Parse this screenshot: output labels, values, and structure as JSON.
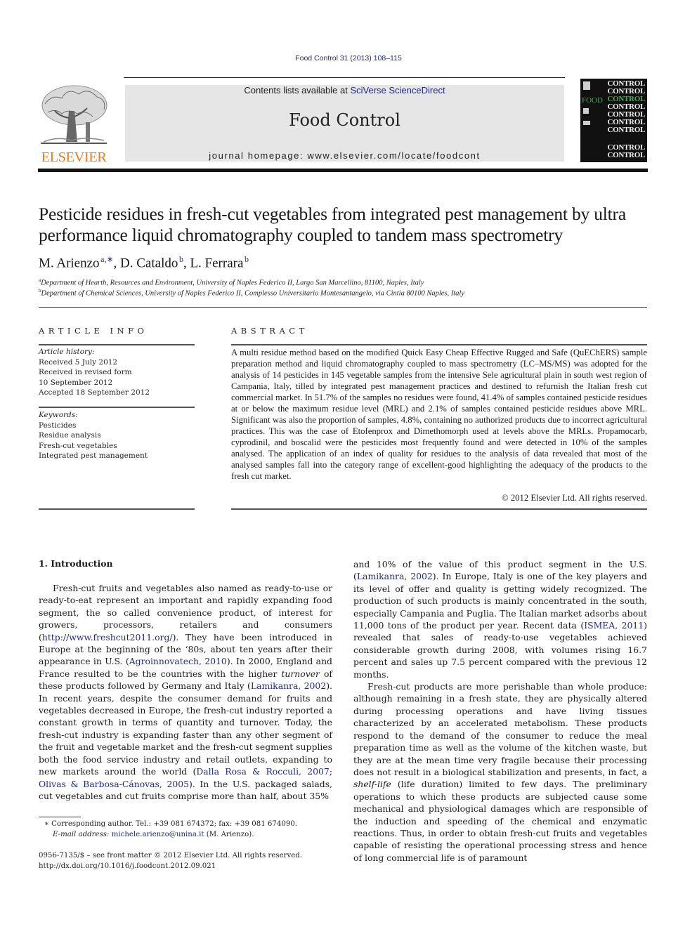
{
  "header": {
    "journal_ref": "Food Control 31 (2013) 108–115",
    "contents_prefix": "Contents lists available at ",
    "contents_link": "SciVerse ScienceDirect",
    "journal_title": "Food Control",
    "homepage": "journal homepage: www.elsevier.com/locate/foodcont",
    "publisher_logo": "ELSEVIER",
    "cover": {
      "word": "CONTROL",
      "food": "FOOD"
    }
  },
  "article": {
    "title": "Pesticide residues in fresh-cut vegetables from integrated pest management by ultra performance liquid chromatography coupled to tandem mass spectrometry",
    "authors": [
      {
        "name": "M. Arienzo",
        "sup": "a,∗",
        "sep": ", "
      },
      {
        "name": "D. Cataldo",
        "sup": "b",
        "sep": ", "
      },
      {
        "name": "L. Ferrara",
        "sup": "b",
        "sep": ""
      }
    ],
    "affiliations": [
      {
        "mark": "a",
        "text": "Department of Hearth, Resources and Environment, University of Naples Federico II, Largo San Marcellino, 81100, Naples, Italy"
      },
      {
        "mark": "b",
        "text": "Department of Chemical Sciences, University of Naples Federico II, Complesso Universitario Montesantangelo, via Cintia 80100 Naples, Italy"
      }
    ]
  },
  "article_info": {
    "heading": "ARTICLE INFO",
    "history_label": "Article history:",
    "history": [
      "Received 5 July 2012",
      "Received in revised form",
      "10 September 2012",
      "Accepted 18 September 2012"
    ],
    "keywords_label": "Keywords:",
    "keywords": [
      "Pesticides",
      "Residue analysis",
      "Fresh-cut vegetables",
      "Integrated pest management"
    ]
  },
  "abstract": {
    "heading": "ABSTRACT",
    "text": "A multi residue method based on the modified Quick Easy Cheap Effective Rugged and Safe (QuEChERS) sample preparation method and liquid chromatography coupled to mass spectrometry (LC–MS/MS) was adopted for the analysis of 14 pesticides in 145 vegetable samples from the intensive Sele agricultural plain in south west region of Campania, Italy, tilled by integrated pest management practices and destined to refurnish the Italian fresh cut commercial market. In 51.7% of the samples no residues were found, 41.4% of samples contained pesticide residues at or below the maximum residue level (MRL) and 2.1% of samples contained pesticide residues above MRL. Significant was also the proportion of samples, 4.8%, containing no authorized products due to incorrect agricultural practices. This was the case of Etofenprox and Dimethomorph used at levels above the MRLs. Propamocarb, cyprodinil, and boscalid were the pesticides most frequently found and were detected in 10% of the samples analysed. The application of an index of quality for residues to the analysis of data revealed that most of the analysed samples fall into the category range of excellent-good highlighting the adequacy of the products to the fresh cut market.",
    "copyright": "© 2012 Elsevier Ltd. All rights reserved."
  },
  "intro": {
    "heading": "1.  Introduction",
    "left": {
      "p1_a": "Fresh-cut fruits and vegetables also named as ready-to-use or ready-to-eat represent an important and rapidly expanding food segment, the so called convenience product, of interest for growers, processors, retailers and consumers (",
      "p1_link1": "http://www.freshcut2011.org/",
      "p1_b": "). They have been introduced in Europe at the beginning of the ‘80s, about ten years after their appearance in U.S. (",
      "p1_link2": "Agroinnovatech, 2010",
      "p1_c": "). In 2000, England and France resulted to be the countries with the higher ",
      "p1_em": "turnover",
      "p1_d": " of these products followed by Germany and Italy (",
      "p1_link3": "Lamikanra, 2002",
      "p1_e": "). In recent years, despite the consumer demand for fruits and vegetables decreased in Europe, the fresh-cut industry reported a constant growth in terms of quantity and turnover. Today, the fresh-cut industry is expanding faster than any other segment of the fruit and vegetable market and the fresh-cut segment supplies both the food service industry and retail outlets, expanding to new markets around the world (",
      "p1_link4": "Dalla Rosa & Rocculi, 2007",
      "p1_f": "; ",
      "p1_link5": "Olivas & Barbosa-Cánovas, 2005",
      "p1_g": "). In the U.S. packaged salads, cut vegetables and cut fruits comprise more than half, about 35%"
    },
    "right": {
      "p1_a": "and 10% of the value of this product segment in the U.S. (",
      "p1_link1": "Lamikanra, 2002",
      "p1_b": "). In Europe, Italy is one of the key players and its level of offer and quality is getting widely recognized. The production of such products is mainly concentrated in the south, especially Campania and Puglia. The Italian market adsorbs about 11,000 tons of the product per year. Recent data (",
      "p1_link2": "ISMEA, 2011",
      "p1_c": ") revealed that sales of ready-to-use vegetables achieved considerable growth during 2008, with volumes rising 16.7 percent and sales up 7.5 percent compared with the previous 12 months.",
      "p2_a": "Fresh-cut products are more perishable than whole produce: although remaining in a fresh state, they are physically altered during processing operations and have living tissues characterized by an accelerated metabolism. These products respond to the demand of the consumer to reduce the meal preparation time as well as the volume of the kitchen waste, but they are at the mean time very fragile because their processing does not result in a biological stabilization and presents, in fact, a ",
      "p2_em": "shelf-life",
      "p2_b": " (life duration) limited to few days. The preliminary operations to which these products are subjected cause some mechanical and physiological damages which are responsible of the induction and speeding of the chemical and enzymatic reactions. Thus, in order to obtain fresh-cut fruits and vegetables capable of resisting the operational processing stress and hence of long commercial life is of paramount"
    }
  },
  "footnotes": {
    "corresponding": "∗  Corresponding author. Tel.: +39 081 674372; fax: +39 081 674090.",
    "email_label": "E-mail address: ",
    "email": "michele.arienzo@unina.it",
    "email_suffix": " (M. Arienzo).",
    "front_matter": "0956-7135/$ – see front matter © 2012 Elsevier Ltd. All rights reserved.",
    "doi": "http://dx.doi.org/10.1016/j.foodcont.2012.09.021"
  }
}
